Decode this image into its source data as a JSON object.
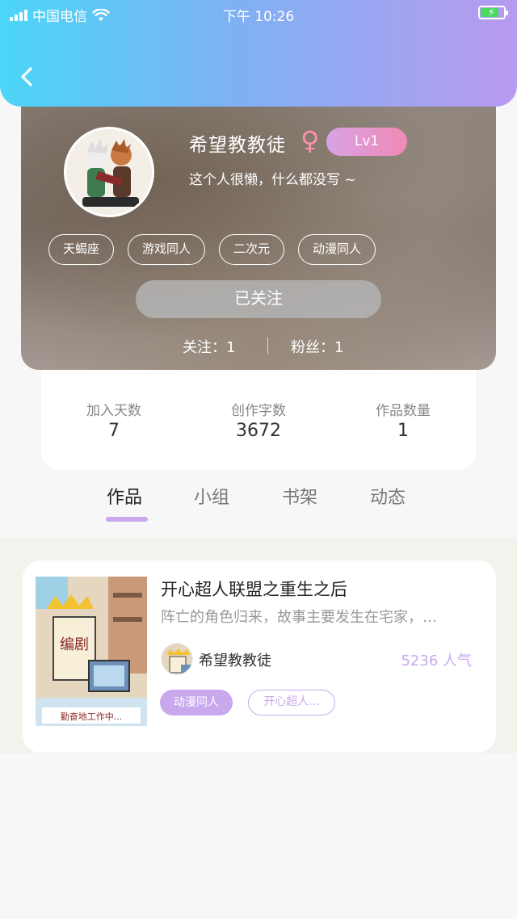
{
  "status_bar": {
    "carrier": "中国电信",
    "time": "下午 10:26"
  },
  "profile": {
    "nickname": "希望教教徒",
    "gender_symbol": "♀",
    "level": "Lv1",
    "bio": "这个人很懒，什么都没写 ~",
    "tags": [
      "天蝎座",
      "游戏同人",
      "二次元",
      "动漫同人"
    ],
    "follow_button": "已关注",
    "following": "关注：1",
    "fans": "粉丝：1"
  },
  "info": {
    "days_label": "加入天数",
    "days_value": "7",
    "words_label": "创作字数",
    "words_value": "3672",
    "works_label": "作品数量",
    "works_value": "1"
  },
  "tabs": [
    {
      "label": "作品",
      "active": true
    },
    {
      "label": "小组",
      "active": false
    },
    {
      "label": "书架",
      "active": false
    },
    {
      "label": "动态",
      "active": false
    }
  ],
  "work": {
    "title": "开心超人联盟之重生之后",
    "description": "阵亡的角色归来，故事主要发生在宅家，…",
    "author": "希望教教徒",
    "popularity": "5236 人气",
    "tags": [
      "动漫同人",
      "开心超人..."
    ],
    "cover_sign": "编剧",
    "cover_banner": "勤奋地工作中..."
  },
  "colors": {
    "accent": "#c9a8ee",
    "header_start": "#4ad6f7",
    "header_end": "#b89af0"
  }
}
